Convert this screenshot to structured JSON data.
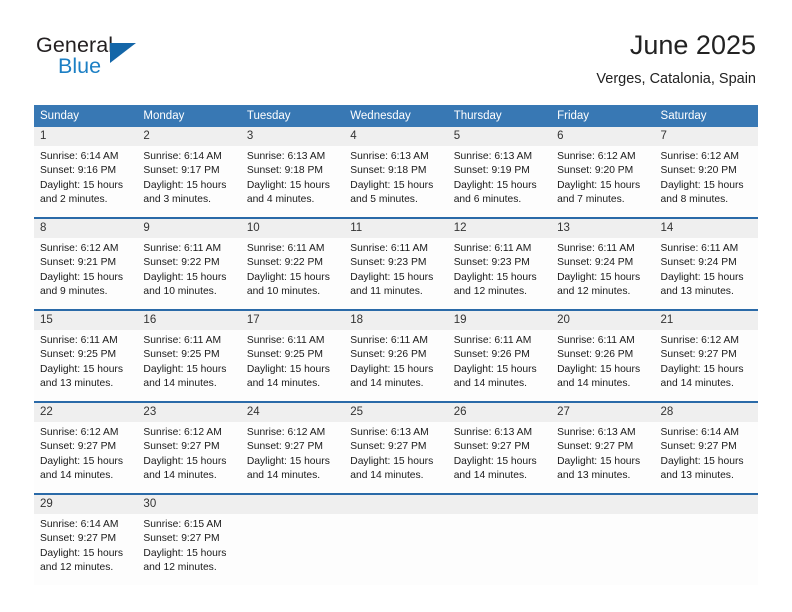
{
  "brand": {
    "name_top": "General",
    "name_bottom": "Blue",
    "accent_color": "#1c7fc4",
    "triangle_color": "#1466a8"
  },
  "header": {
    "title": "June 2025",
    "subtitle": "Verges, Catalonia, Spain"
  },
  "theme": {
    "header_row_bg": "#3878b4",
    "row_separator": "#2a6aa8",
    "daynum_bg": "#efefef",
    "cell_bg": "#fdfdfd"
  },
  "weekdays": [
    "Sunday",
    "Monday",
    "Tuesday",
    "Wednesday",
    "Thursday",
    "Friday",
    "Saturday"
  ],
  "labels": {
    "sunrise": "Sunrise:",
    "sunset": "Sunset:",
    "daylight": "Daylight:"
  },
  "weeks": [
    [
      {
        "day": "1",
        "sunrise": "Sunrise: 6:14 AM",
        "sunset": "Sunset: 9:16 PM",
        "daylight_line1": "Daylight: 15 hours",
        "daylight_line2": "and 2 minutes."
      },
      {
        "day": "2",
        "sunrise": "Sunrise: 6:14 AM",
        "sunset": "Sunset: 9:17 PM",
        "daylight_line1": "Daylight: 15 hours",
        "daylight_line2": "and 3 minutes."
      },
      {
        "day": "3",
        "sunrise": "Sunrise: 6:13 AM",
        "sunset": "Sunset: 9:18 PM",
        "daylight_line1": "Daylight: 15 hours",
        "daylight_line2": "and 4 minutes."
      },
      {
        "day": "4",
        "sunrise": "Sunrise: 6:13 AM",
        "sunset": "Sunset: 9:18 PM",
        "daylight_line1": "Daylight: 15 hours",
        "daylight_line2": "and 5 minutes."
      },
      {
        "day": "5",
        "sunrise": "Sunrise: 6:13 AM",
        "sunset": "Sunset: 9:19 PM",
        "daylight_line1": "Daylight: 15 hours",
        "daylight_line2": "and 6 minutes."
      },
      {
        "day": "6",
        "sunrise": "Sunrise: 6:12 AM",
        "sunset": "Sunset: 9:20 PM",
        "daylight_line1": "Daylight: 15 hours",
        "daylight_line2": "and 7 minutes."
      },
      {
        "day": "7",
        "sunrise": "Sunrise: 6:12 AM",
        "sunset": "Sunset: 9:20 PM",
        "daylight_line1": "Daylight: 15 hours",
        "daylight_line2": "and 8 minutes."
      }
    ],
    [
      {
        "day": "8",
        "sunrise": "Sunrise: 6:12 AM",
        "sunset": "Sunset: 9:21 PM",
        "daylight_line1": "Daylight: 15 hours",
        "daylight_line2": "and 9 minutes."
      },
      {
        "day": "9",
        "sunrise": "Sunrise: 6:11 AM",
        "sunset": "Sunset: 9:22 PM",
        "daylight_line1": "Daylight: 15 hours",
        "daylight_line2": "and 10 minutes."
      },
      {
        "day": "10",
        "sunrise": "Sunrise: 6:11 AM",
        "sunset": "Sunset: 9:22 PM",
        "daylight_line1": "Daylight: 15 hours",
        "daylight_line2": "and 10 minutes."
      },
      {
        "day": "11",
        "sunrise": "Sunrise: 6:11 AM",
        "sunset": "Sunset: 9:23 PM",
        "daylight_line1": "Daylight: 15 hours",
        "daylight_line2": "and 11 minutes."
      },
      {
        "day": "12",
        "sunrise": "Sunrise: 6:11 AM",
        "sunset": "Sunset: 9:23 PM",
        "daylight_line1": "Daylight: 15 hours",
        "daylight_line2": "and 12 minutes."
      },
      {
        "day": "13",
        "sunrise": "Sunrise: 6:11 AM",
        "sunset": "Sunset: 9:24 PM",
        "daylight_line1": "Daylight: 15 hours",
        "daylight_line2": "and 12 minutes."
      },
      {
        "day": "14",
        "sunrise": "Sunrise: 6:11 AM",
        "sunset": "Sunset: 9:24 PM",
        "daylight_line1": "Daylight: 15 hours",
        "daylight_line2": "and 13 minutes."
      }
    ],
    [
      {
        "day": "15",
        "sunrise": "Sunrise: 6:11 AM",
        "sunset": "Sunset: 9:25 PM",
        "daylight_line1": "Daylight: 15 hours",
        "daylight_line2": "and 13 minutes."
      },
      {
        "day": "16",
        "sunrise": "Sunrise: 6:11 AM",
        "sunset": "Sunset: 9:25 PM",
        "daylight_line1": "Daylight: 15 hours",
        "daylight_line2": "and 14 minutes."
      },
      {
        "day": "17",
        "sunrise": "Sunrise: 6:11 AM",
        "sunset": "Sunset: 9:25 PM",
        "daylight_line1": "Daylight: 15 hours",
        "daylight_line2": "and 14 minutes."
      },
      {
        "day": "18",
        "sunrise": "Sunrise: 6:11 AM",
        "sunset": "Sunset: 9:26 PM",
        "daylight_line1": "Daylight: 15 hours",
        "daylight_line2": "and 14 minutes."
      },
      {
        "day": "19",
        "sunrise": "Sunrise: 6:11 AM",
        "sunset": "Sunset: 9:26 PM",
        "daylight_line1": "Daylight: 15 hours",
        "daylight_line2": "and 14 minutes."
      },
      {
        "day": "20",
        "sunrise": "Sunrise: 6:11 AM",
        "sunset": "Sunset: 9:26 PM",
        "daylight_line1": "Daylight: 15 hours",
        "daylight_line2": "and 14 minutes."
      },
      {
        "day": "21",
        "sunrise": "Sunrise: 6:12 AM",
        "sunset": "Sunset: 9:27 PM",
        "daylight_line1": "Daylight: 15 hours",
        "daylight_line2": "and 14 minutes."
      }
    ],
    [
      {
        "day": "22",
        "sunrise": "Sunrise: 6:12 AM",
        "sunset": "Sunset: 9:27 PM",
        "daylight_line1": "Daylight: 15 hours",
        "daylight_line2": "and 14 minutes."
      },
      {
        "day": "23",
        "sunrise": "Sunrise: 6:12 AM",
        "sunset": "Sunset: 9:27 PM",
        "daylight_line1": "Daylight: 15 hours",
        "daylight_line2": "and 14 minutes."
      },
      {
        "day": "24",
        "sunrise": "Sunrise: 6:12 AM",
        "sunset": "Sunset: 9:27 PM",
        "daylight_line1": "Daylight: 15 hours",
        "daylight_line2": "and 14 minutes."
      },
      {
        "day": "25",
        "sunrise": "Sunrise: 6:13 AM",
        "sunset": "Sunset: 9:27 PM",
        "daylight_line1": "Daylight: 15 hours",
        "daylight_line2": "and 14 minutes."
      },
      {
        "day": "26",
        "sunrise": "Sunrise: 6:13 AM",
        "sunset": "Sunset: 9:27 PM",
        "daylight_line1": "Daylight: 15 hours",
        "daylight_line2": "and 14 minutes."
      },
      {
        "day": "27",
        "sunrise": "Sunrise: 6:13 AM",
        "sunset": "Sunset: 9:27 PM",
        "daylight_line1": "Daylight: 15 hours",
        "daylight_line2": "and 13 minutes."
      },
      {
        "day": "28",
        "sunrise": "Sunrise: 6:14 AM",
        "sunset": "Sunset: 9:27 PM",
        "daylight_line1": "Daylight: 15 hours",
        "daylight_line2": "and 13 minutes."
      }
    ],
    [
      {
        "day": "29",
        "sunrise": "Sunrise: 6:14 AM",
        "sunset": "Sunset: 9:27 PM",
        "daylight_line1": "Daylight: 15 hours",
        "daylight_line2": "and 12 minutes."
      },
      {
        "day": "30",
        "sunrise": "Sunrise: 6:15 AM",
        "sunset": "Sunset: 9:27 PM",
        "daylight_line1": "Daylight: 15 hours",
        "daylight_line2": "and 12 minutes."
      },
      {
        "day": "",
        "sunrise": "",
        "sunset": "",
        "daylight_line1": "",
        "daylight_line2": ""
      },
      {
        "day": "",
        "sunrise": "",
        "sunset": "",
        "daylight_line1": "",
        "daylight_line2": ""
      },
      {
        "day": "",
        "sunrise": "",
        "sunset": "",
        "daylight_line1": "",
        "daylight_line2": ""
      },
      {
        "day": "",
        "sunrise": "",
        "sunset": "",
        "daylight_line1": "",
        "daylight_line2": ""
      },
      {
        "day": "",
        "sunrise": "",
        "sunset": "",
        "daylight_line1": "",
        "daylight_line2": ""
      }
    ]
  ]
}
